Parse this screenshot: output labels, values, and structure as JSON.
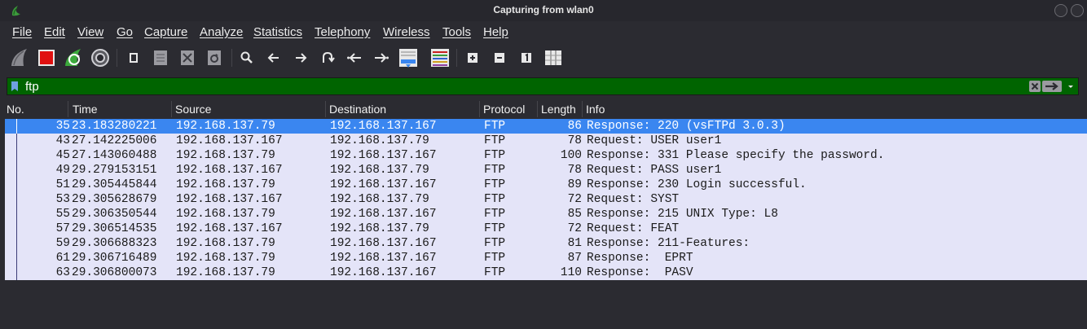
{
  "window": {
    "title": "Capturing from wlan0"
  },
  "menu": [
    "File",
    "Edit",
    "View",
    "Go",
    "Capture",
    "Analyze",
    "Statistics",
    "Telephony",
    "Wireless",
    "Tools",
    "Help"
  ],
  "toolbar": {
    "icons": [
      "start-capture-icon",
      "stop-capture-icon",
      "restart-capture-icon",
      "capture-options-icon",
      "open-file-icon",
      "save-file-icon",
      "close-file-icon",
      "reload-file-icon",
      "find-packet-icon",
      "go-back-icon",
      "go-forward-icon",
      "go-to-packet-icon",
      "first-packet-icon",
      "last-packet-icon",
      "autoscroll-icon",
      "colorize-icon",
      "zoom-in-icon",
      "zoom-out-icon",
      "normal-size-icon",
      "resize-columns-icon"
    ]
  },
  "filter": {
    "value": "ftp"
  },
  "columns": [
    "No.",
    "Time",
    "Source",
    "Destination",
    "Protocol",
    "Length",
    "Info"
  ],
  "packets": [
    {
      "no": "35",
      "time": "23.183280221",
      "src": "192.168.137.79",
      "dst": "192.168.137.167",
      "proto": "FTP",
      "len": "86",
      "info": "Response: 220 (vsFTPd 3.0.3)",
      "selected": true
    },
    {
      "no": "43",
      "time": "27.142225006",
      "src": "192.168.137.167",
      "dst": "192.168.137.79",
      "proto": "FTP",
      "len": "78",
      "info": "Request: USER user1"
    },
    {
      "no": "45",
      "time": "27.143060488",
      "src": "192.168.137.79",
      "dst": "192.168.137.167",
      "proto": "FTP",
      "len": "100",
      "info": "Response: 331 Please specify the password."
    },
    {
      "no": "49",
      "time": "29.279153151",
      "src": "192.168.137.167",
      "dst": "192.168.137.79",
      "proto": "FTP",
      "len": "78",
      "info": "Request: PASS user1"
    },
    {
      "no": "51",
      "time": "29.305445844",
      "src": "192.168.137.79",
      "dst": "192.168.137.167",
      "proto": "FTP",
      "len": "89",
      "info": "Response: 230 Login successful."
    },
    {
      "no": "53",
      "time": "29.305628679",
      "src": "192.168.137.167",
      "dst": "192.168.137.79",
      "proto": "FTP",
      "len": "72",
      "info": "Request: SYST"
    },
    {
      "no": "55",
      "time": "29.306350544",
      "src": "192.168.137.79",
      "dst": "192.168.137.167",
      "proto": "FTP",
      "len": "85",
      "info": "Response: 215 UNIX Type: L8"
    },
    {
      "no": "57",
      "time": "29.306514535",
      "src": "192.168.137.167",
      "dst": "192.168.137.79",
      "proto": "FTP",
      "len": "72",
      "info": "Request: FEAT"
    },
    {
      "no": "59",
      "time": "29.306688323",
      "src": "192.168.137.79",
      "dst": "192.168.137.167",
      "proto": "FTP",
      "len": "81",
      "info": "Response: 211-Features:"
    },
    {
      "no": "61",
      "time": "29.306716489",
      "src": "192.168.137.79",
      "dst": "192.168.137.167",
      "proto": "FTP",
      "len": "87",
      "info": "Response:  EPRT"
    },
    {
      "no": "63",
      "time": "29.306800073",
      "src": "192.168.137.79",
      "dst": "192.168.137.167",
      "proto": "FTP",
      "len": "110",
      "info": "Response:  PASV"
    }
  ]
}
